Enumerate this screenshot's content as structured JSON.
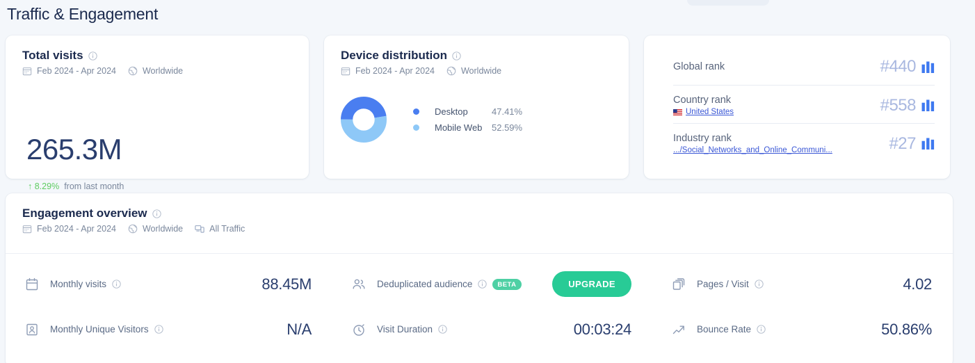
{
  "page": {
    "title": "Traffic & Engagement"
  },
  "colors": {
    "background": "#f4f7fb",
    "card": "#ffffff",
    "text_dark": "#1b2a4e",
    "text_muted": "#7a879c",
    "accent_blue": "#4a7ef0",
    "accent_light_blue": "#8ec8f7",
    "positive_green": "#5fcc62",
    "upgrade_green": "#28cb96",
    "beta_green": "#4ed0a4",
    "link_blue": "#3a57d6",
    "rank_value": "#a9b8e0"
  },
  "total_visits": {
    "title": "Total visits",
    "info_icon": "info-circle-icon",
    "date_icon": "calendar-icon",
    "date_range": "Feb 2024 - Apr 2024",
    "geo_icon": "globe-icon",
    "geo": "Worldwide",
    "value": "265.3M",
    "delta_icon": "arrow-up-icon",
    "delta": "8.29%",
    "delta_note": "from last month"
  },
  "device_distribution": {
    "title": "Device distribution",
    "info_icon": "info-circle-icon",
    "date_icon": "calendar-icon",
    "date_range": "Feb 2024 - Apr 2024",
    "geo_icon": "globe-icon",
    "geo": "Worldwide",
    "legend": [
      {
        "label": "Desktop",
        "value": "47.41%",
        "color": "#4a7ef0"
      },
      {
        "label": "Mobile Web",
        "value": "52.59%",
        "color": "#8ec8f7"
      }
    ]
  },
  "chart_data": {
    "type": "pie",
    "title": "Device distribution",
    "categories": [
      "Desktop",
      "Mobile Web"
    ],
    "values": [
      47.41,
      52.59
    ],
    "colors": [
      "#4a7ef0",
      "#8ec8f7"
    ],
    "units": "%",
    "legend_position": "right",
    "donut": true,
    "inner_radius_ratio": 0.55
  },
  "ranks": [
    {
      "name": "Global rank",
      "value": "#440",
      "bars_icon": "bar-chart-icon",
      "sub_link": null,
      "flag_icon": null
    },
    {
      "name": "Country rank",
      "value": "#558",
      "bars_icon": "bar-chart-icon",
      "sub_link": "United States",
      "flag_icon": "us-flag-icon"
    },
    {
      "name": "Industry rank",
      "value": "#27",
      "bars_icon": "bar-chart-icon",
      "sub_link": ".../Social_Networks_and_Online_Communi...",
      "flag_icon": null
    }
  ],
  "engagement": {
    "title": "Engagement overview",
    "info_icon": "info-circle-icon",
    "date_icon": "calendar-icon",
    "date_range": "Feb 2024 - Apr 2024",
    "geo_icon": "globe-icon",
    "geo": "Worldwide",
    "traffic_icon": "devices-icon",
    "traffic": "All Traffic",
    "metrics": [
      {
        "icon": "calendar-month-icon",
        "label": "Monthly visits",
        "value": "88.45M",
        "info_icon": "info-circle-icon"
      },
      {
        "icon": "people-icon",
        "label": "Deduplicated audience",
        "value": "UPGRADE",
        "info_icon": "info-circle-icon",
        "badge": "BETA",
        "is_button": true
      },
      {
        "icon": "pages-icon",
        "label": "Pages / Visit",
        "value": "4.02",
        "info_icon": "info-circle-icon"
      },
      {
        "icon": "visitor-card-icon",
        "label": "Monthly Unique Visitors",
        "value": "N/A",
        "info_icon": "info-circle-icon"
      },
      {
        "icon": "stopwatch-icon",
        "label": "Visit Duration",
        "value": "00:03:24",
        "info_icon": "info-circle-icon"
      },
      {
        "icon": "bounce-arrow-icon",
        "label": "Bounce Rate",
        "value": "50.86%",
        "info_icon": "info-circle-icon"
      }
    ]
  }
}
